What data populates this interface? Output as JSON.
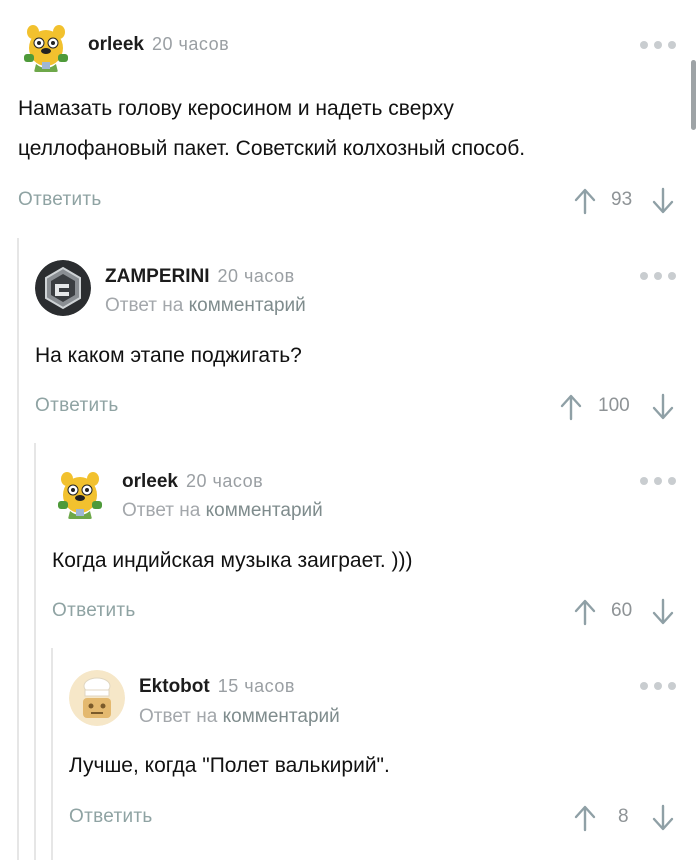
{
  "reply_link_text": "комментарий",
  "reply_prefix": "Ответ на",
  "comments": [
    {
      "author": "orleek",
      "time": "20 часов",
      "text_lines": [
        "Намазать голову керосином и надеть сверху",
        "целлофановый пакет. Советский колхозный способ."
      ],
      "reply_label": "Ответить",
      "votes": "93",
      "avatar": "jake-dog-avatar"
    },
    {
      "author": "ZAMPERINI",
      "time": "20 часов",
      "text_lines": [
        "На каком этапе поджигать?"
      ],
      "reply_label": "Ответить",
      "votes": "100",
      "avatar": "metal-logo-avatar"
    },
    {
      "author": "orleek",
      "time": "20 часов",
      "text_lines": [
        "Когда индийская музыка заиграет. )))"
      ],
      "reply_label": "Ответить",
      "votes": "60",
      "avatar": "jake-dog-avatar"
    },
    {
      "author": "Ektobot",
      "time": "15 часов",
      "text_lines": [
        "Лучше, когда \"Полет валькирий\"."
      ],
      "reply_label": "Ответить",
      "votes": "8",
      "avatar": "robot-chef-avatar"
    }
  ]
}
